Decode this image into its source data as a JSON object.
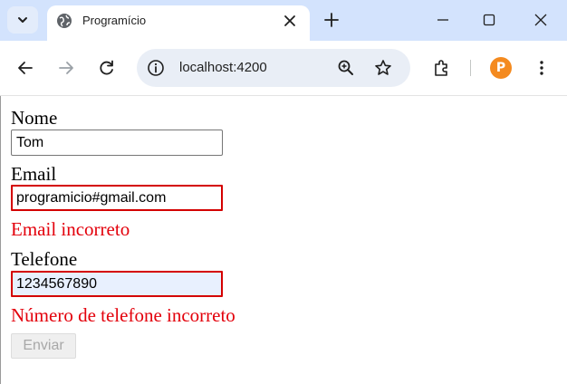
{
  "browser": {
    "tab": {
      "title": "Programício"
    },
    "address_bar": {
      "url": "localhost:4200"
    },
    "profile": {
      "initial": "P",
      "color": "#f48a1f"
    }
  },
  "form": {
    "nome": {
      "label": "Nome",
      "value": "Tom"
    },
    "email": {
      "label": "Email",
      "value": "programicio#gmail.com",
      "error": "Email incorreto"
    },
    "telefone": {
      "label": "Telefone",
      "value": "1234567890",
      "error": "Número de telefone incorreto"
    },
    "submit": {
      "label": "Enviar",
      "disabled": true
    }
  },
  "colors": {
    "error": "#e3000b",
    "invalid_border": "#d40000",
    "tab_strip": "#d3e3fd"
  },
  "icons": [
    "tab-search-icon",
    "globe-icon",
    "close-icon",
    "plus-icon",
    "minimize-icon",
    "maximize-icon",
    "window-close-icon",
    "back-arrow-icon",
    "forward-arrow-icon",
    "reload-icon",
    "site-info-icon",
    "zoom-icon",
    "bookmark-star-icon",
    "extensions-icon",
    "menu-kebab-icon"
  ]
}
